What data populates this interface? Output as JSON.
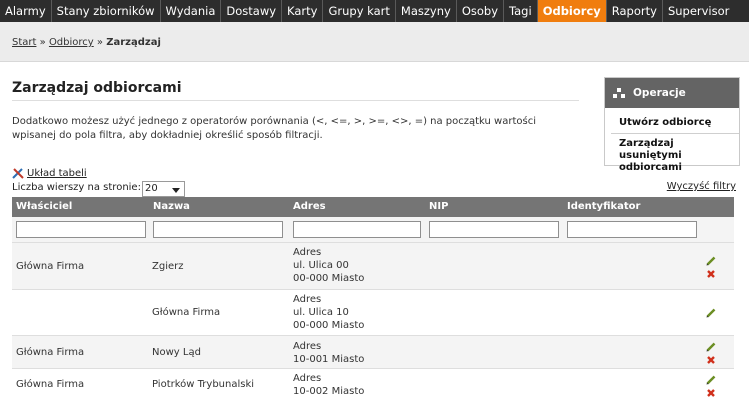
{
  "nav": {
    "items": [
      "Alarmy",
      "Stany zbiorników",
      "Wydania",
      "Dostawy",
      "Karty",
      "Grupy kart",
      "Maszyny",
      "Osoby",
      "Tagi",
      "Odbiorcy",
      "Raporty",
      "Supervisor"
    ],
    "active": "Odbiorcy",
    "active_color": "#f07d0e"
  },
  "breadcrumb": {
    "start": "Start",
    "sep1": "»",
    "section": "Odbiorcy",
    "sep2": "»",
    "current": "Zarządzaj"
  },
  "page": {
    "title": "Zarządzaj odbiorcami",
    "description": "Dodatkowo możesz użyć jednego z operatorów porównania (<, <=, >, >=, <>, =) na początku wartości wpisanej do pola filtra, aby dokładniej określić sposób filtracji."
  },
  "operations": {
    "title": "Operacje",
    "create": "Utwórz odbiorcę",
    "manage_deleted": "Zarządzaj usuniętymi odbiorcami"
  },
  "table_controls": {
    "layout_link": "Układ tabeli",
    "rows_label": "Liczba wierszy na stronie:",
    "rows_value": "20",
    "clear_filters": "Wyczyść filtry"
  },
  "table": {
    "columns": [
      "Właściciel",
      "Nazwa",
      "Adres",
      "NIP",
      "Identyfikator"
    ],
    "rows": [
      {
        "owner": "Główna Firma",
        "name": "Zgierz",
        "address": [
          "Adres",
          "ul. Ulica 00",
          "00-000 Miasto"
        ],
        "nip": "",
        "identifier": "",
        "actions": [
          "edit",
          "delete"
        ]
      },
      {
        "owner": "",
        "name": "Główna Firma",
        "address": [
          "Adres",
          "ul. Ulica 10",
          "00-000 Miasto"
        ],
        "nip": "",
        "identifier": "",
        "actions": [
          "edit"
        ]
      },
      {
        "owner": "Główna Firma",
        "name": "Nowy Ląd",
        "address": [
          "Adres",
          "10-001 Miasto"
        ],
        "nip": "",
        "identifier": "",
        "actions": [
          "edit",
          "delete"
        ]
      },
      {
        "owner": "Główna Firma",
        "name": "Piotrków Trybunalski",
        "address": [
          "Adres",
          "10-002 Miasto"
        ],
        "nip": "",
        "identifier": "",
        "actions": [
          "edit",
          "delete"
        ]
      }
    ]
  },
  "icons": {
    "layout": "wrench-pencil-icon",
    "operations": "boxes-icon",
    "edit": "pencil-icon",
    "delete": "red-x-icon"
  }
}
